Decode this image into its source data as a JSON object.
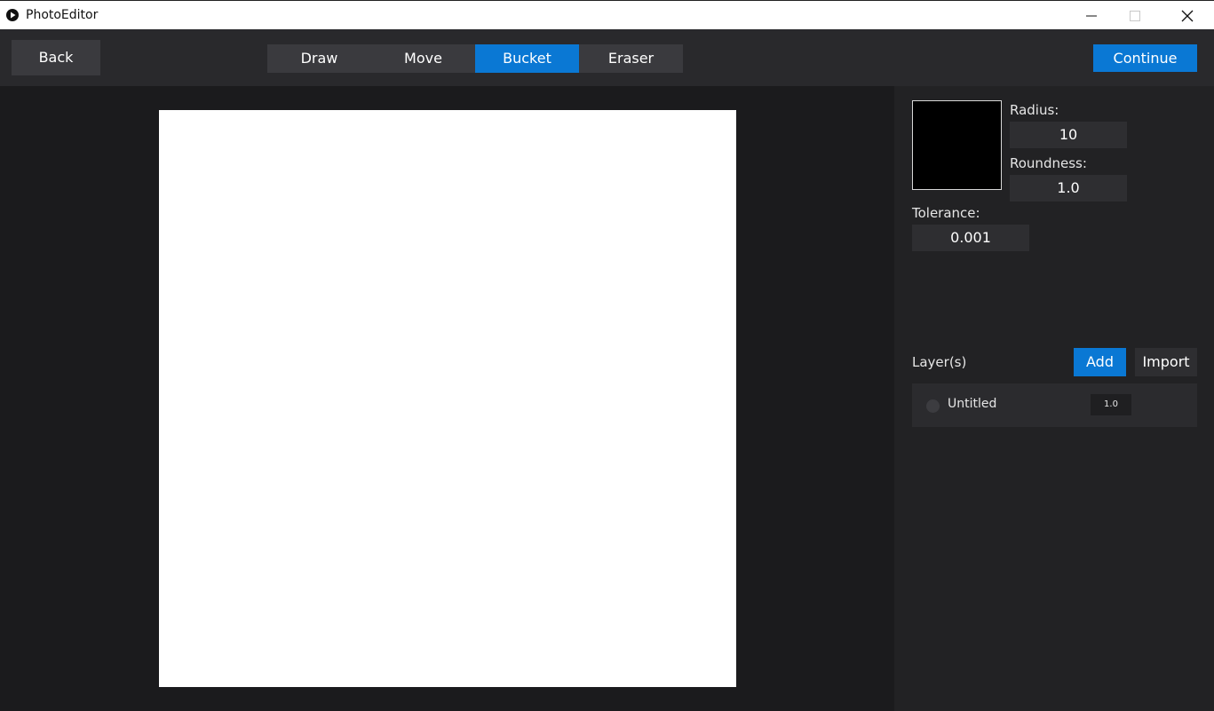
{
  "window": {
    "title": "PhotoEditor",
    "icons": [
      "app-play-icon",
      "minimize-icon",
      "maximize-icon",
      "close-icon"
    ]
  },
  "toolbar": {
    "back_label": "Back",
    "tools": [
      {
        "label": "Draw",
        "active": false
      },
      {
        "label": "Move",
        "active": false
      },
      {
        "label": "Bucket",
        "active": true
      },
      {
        "label": "Eraser",
        "active": false
      }
    ],
    "continue_label": "Continue",
    "accent_color": "#0a78d4"
  },
  "canvas": {
    "background_color": "#ffffff"
  },
  "brush": {
    "color": "#000000",
    "radius_label": "Radius:",
    "radius_value": "10",
    "roundness_label": "Roundness:",
    "roundness_value": "1.0",
    "tolerance_label": "Tolerance:",
    "tolerance_value": "0.001"
  },
  "layers": {
    "header": "Layer(s)",
    "add_label": "Add",
    "import_label": "Import",
    "items": [
      {
        "name": "Untitled",
        "opacity": "1.0"
      }
    ]
  }
}
